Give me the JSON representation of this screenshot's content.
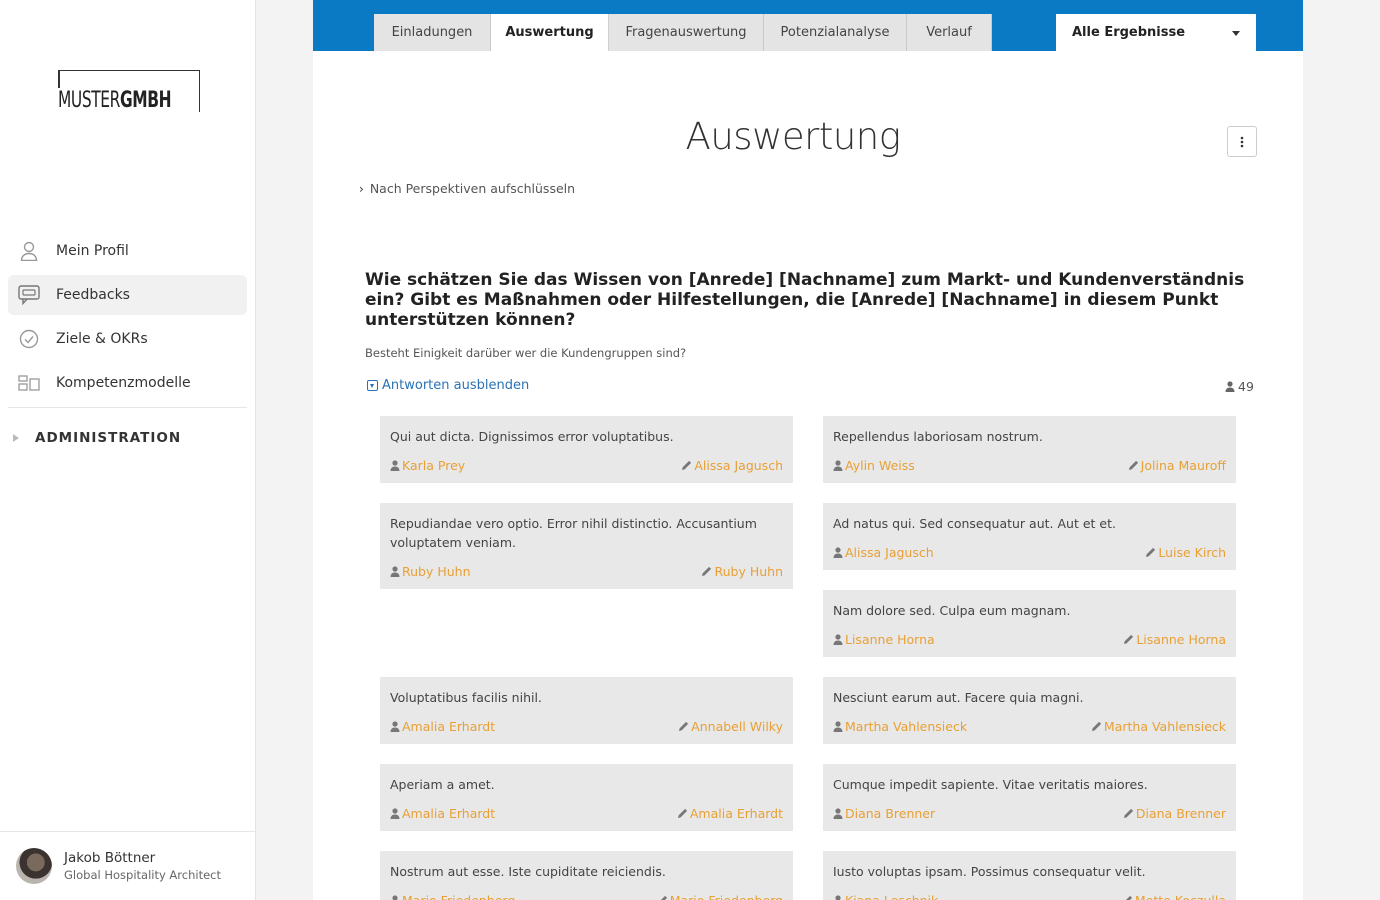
{
  "logo": {
    "part1": "MUSTER",
    "part2": "GMBH"
  },
  "nav": {
    "items": [
      {
        "label": "Mein Profil",
        "icon": "user-icon"
      },
      {
        "label": "Feedbacks",
        "icon": "chat-icon"
      },
      {
        "label": "Ziele & OKRs",
        "icon": "check-circle-icon"
      },
      {
        "label": "Kompetenzmodelle",
        "icon": "modules-icon"
      }
    ],
    "admin_label": "ADMINISTRATION"
  },
  "user": {
    "name": "Jakob Böttner",
    "role": "Global Hospitality Architect"
  },
  "tabs": [
    "Einladungen",
    "Auswertung",
    "Fragenauswertung",
    "Potenzialanalyse",
    "Verlauf"
  ],
  "active_tab": "Auswertung",
  "filter_select": {
    "value": "Alle Ergebnisse"
  },
  "page": {
    "title": "Auswertung",
    "breakdown_label": "Nach Perspektiven aufschlüsseln",
    "question": "Wie schätzen Sie das Wissen von [Anrede] [Nachname] zum Markt- und Kundenverständnis ein? Gibt es Maßnahmen oder Hilfestellungen, die [Anrede] [Nachname] in diesem Punkt unterstützen können?",
    "subquestion": "Besteht Einigkeit darüber wer die Kundengruppen sind?",
    "toggle_label": "Antworten ausblenden",
    "count": "49"
  },
  "answers": [
    {
      "text": "Qui aut dicta. Dignissimos error voluptatibus.",
      "person": "Karla Prey",
      "author": "Alissa Jagusch"
    },
    {
      "text": "Repellendus laboriosam nostrum.",
      "person": "Aylin Weiss",
      "author": "Jolina Mauroff"
    },
    {
      "text": "Repudiandae vero optio. Error nihil distinctio. Accusantium voluptatem veniam.",
      "person": "Ruby Huhn",
      "author": "Ruby Huhn"
    },
    {
      "text": "Ad natus qui. Sed consequatur aut. Aut et et.",
      "person": "Alissa Jagusch",
      "author": "Luise Kirch"
    },
    {
      "text": "Nam dolore sed. Culpa eum magnam.",
      "person": "Lisanne Horna",
      "author": "Lisanne Horna"
    },
    {
      "text": "Voluptatibus facilis nihil.",
      "person": "Amalia Erhardt",
      "author": "Annabell Wilky"
    },
    {
      "text": "Nesciunt earum aut. Facere quia magni.",
      "person": "Martha Vahlensieck",
      "author": "Martha Vahlensieck"
    },
    {
      "text": "Aperiam a amet.",
      "person": "Amalia Erhardt",
      "author": "Amalia Erhardt"
    },
    {
      "text": "Cumque impedit sapiente. Vitae veritatis maiores.",
      "person": "Diana Brenner",
      "author": "Diana Brenner"
    },
    {
      "text": "Nostrum aut esse. Iste cupiditate reiciendis.",
      "person": "Mario Friedenberg",
      "author": "Mario Friedenberg"
    },
    {
      "text": "Iusto voluptas ipsam. Possimus consequatur velit.",
      "person": "Kiana Leschnik",
      "author": "Mette Koczulla"
    }
  ],
  "colors": {
    "brand_blue": "#0a7ac4",
    "link_orange": "#e8a035",
    "link_blue": "#2a72b5"
  }
}
